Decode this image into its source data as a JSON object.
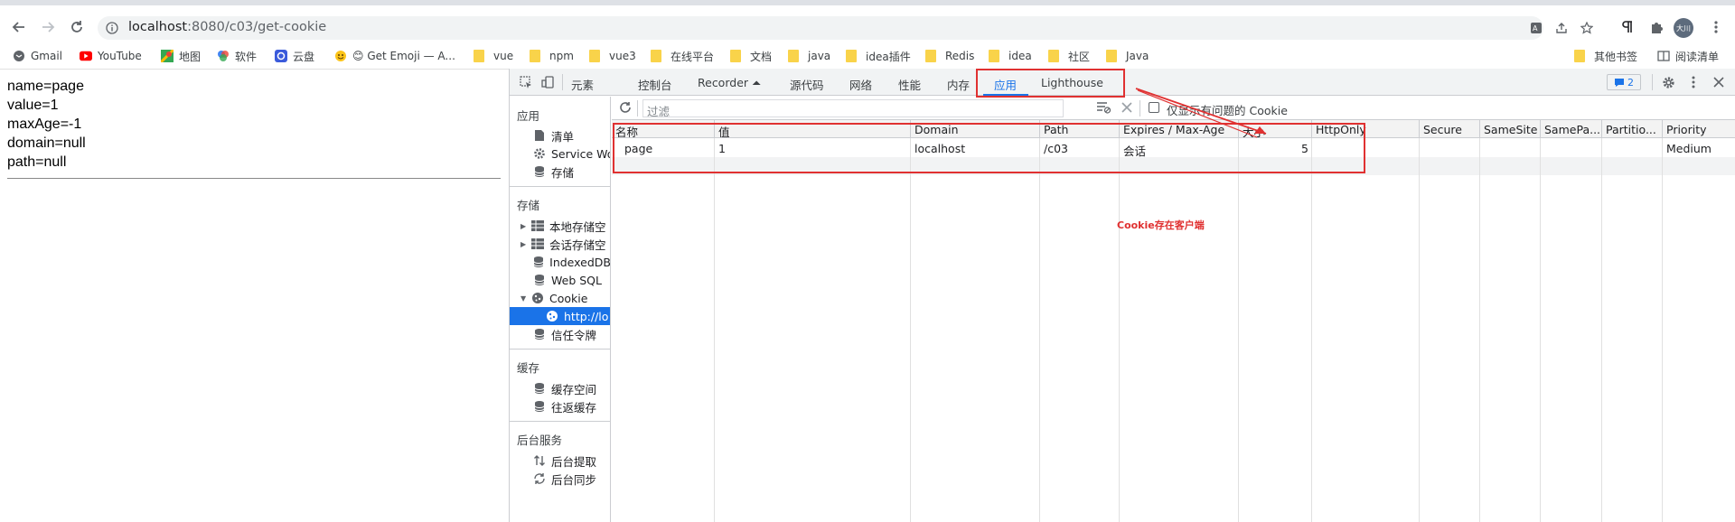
{
  "browser": {
    "url_host": "localhost",
    "url_path": ":8080/c03/get-cookie",
    "profile_label": "大川"
  },
  "bookmarks": [
    {
      "label": "Gmail",
      "icon": "gmail-icon"
    },
    {
      "label": "YouTube",
      "icon": "youtube-icon"
    },
    {
      "label": "地图",
      "icon": "maps-icon"
    },
    {
      "label": "软件",
      "icon": "apps-icon"
    },
    {
      "label": "云盘",
      "icon": "cloud-icon"
    },
    {
      "label": "😊 Get Emoji — A...",
      "icon": "emoji-icon"
    },
    {
      "label": "vue",
      "icon": "folder-icon"
    },
    {
      "label": "npm",
      "icon": "folder-icon"
    },
    {
      "label": "vue3",
      "icon": "folder-icon"
    },
    {
      "label": "在线平台",
      "icon": "folder-icon"
    },
    {
      "label": "文档",
      "icon": "folder-icon"
    },
    {
      "label": "java",
      "icon": "folder-icon"
    },
    {
      "label": "idea插件",
      "icon": "folder-icon"
    },
    {
      "label": "Redis",
      "icon": "folder-icon"
    },
    {
      "label": "idea",
      "icon": "folder-icon"
    },
    {
      "label": "社区",
      "icon": "folder-icon"
    },
    {
      "label": "Java",
      "icon": "folder-icon"
    }
  ],
  "bookmarks_right": {
    "other": "其他书签",
    "reading": "阅读清单"
  },
  "page": {
    "lines": [
      "name=page",
      "value=1",
      "maxAge=-1",
      "domain=null",
      "path=null"
    ]
  },
  "devtools": {
    "tabs": [
      "元素",
      "控制台",
      "Recorder ⏶",
      "源代码",
      "网络",
      "性能",
      "内存",
      "应用",
      "Lighthouse"
    ],
    "active_tab": "应用",
    "issues_count": "2",
    "sidebar": {
      "section_app": "应用",
      "app_items": [
        "清单",
        "Service Wo",
        "存储"
      ],
      "section_storage": "存储",
      "storage_items": [
        "本地存储空",
        "会话存储空",
        "IndexedDB",
        "Web SQL",
        "Cookie",
        "http://lo",
        "信任令牌"
      ],
      "section_cache": "缓存",
      "cache_items": [
        "缓存空间",
        "往返缓存"
      ],
      "section_bg": "后台服务",
      "bg_items": [
        "后台提取",
        "后台同步"
      ]
    },
    "filter_placeholder": "过滤",
    "only_issues_label": "仅显示有问题的 Cookie",
    "columns": [
      "名称",
      "值",
      "Domain",
      "Path",
      "Expires / Max-Age",
      "大小",
      "HttpOnly",
      "Secure",
      "SameSite",
      "SamePa...",
      "Partitio...",
      "Priority"
    ],
    "rows": [
      [
        "page",
        "1",
        "localhost",
        "/c03",
        "会话",
        "5",
        "",
        "",
        "",
        "",
        "",
        "Medium"
      ]
    ]
  },
  "annotation": {
    "text": "Cookie存在客户端",
    "color": "#e03131"
  }
}
